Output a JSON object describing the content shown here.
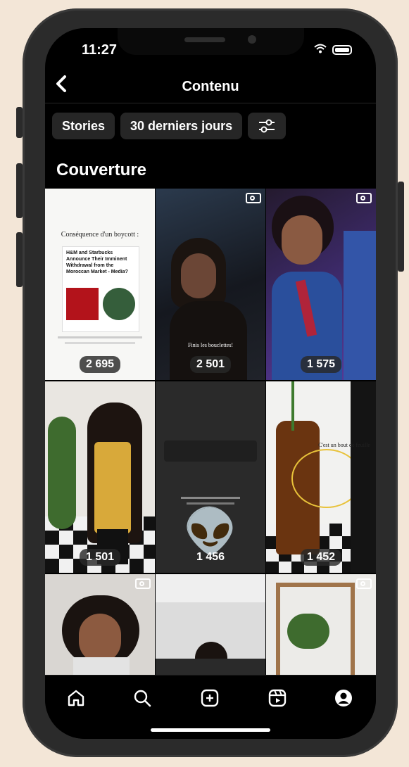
{
  "status_bar": {
    "time": "11:27"
  },
  "header": {
    "title": "Contenu",
    "back_icon": "chevron-left-icon"
  },
  "filters": {
    "chips": [
      {
        "label": "Stories"
      },
      {
        "label": "30 derniers jours"
      }
    ],
    "settings_icon": "sliders-icon"
  },
  "section": {
    "title": "Couverture"
  },
  "grid": {
    "items": [
      {
        "count": "2 695",
        "text": "Conséquence d'un boycott :",
        "headline": "H&M and Starbucks Announce Their Imminent Withdrawal from the Moroccan Market - Media?",
        "reel": false
      },
      {
        "count": "2 501",
        "text": "Finis les bouclettes!",
        "reel": true
      },
      {
        "count": "1 575",
        "reel": true
      },
      {
        "count": "1 501",
        "reel": false
      },
      {
        "count": "1 456",
        "emoji": "👽",
        "reel": false
      },
      {
        "count": "1 452",
        "text": "C'est un bout de feuille",
        "reel": false
      },
      {
        "count": "",
        "reel": true
      },
      {
        "count": "",
        "reel": true
      },
      {
        "count": "",
        "reel": true
      }
    ]
  },
  "nav": {
    "items": [
      "home-icon",
      "search-icon",
      "create-icon",
      "reels-icon",
      "profile-icon"
    ]
  },
  "colors": {
    "background": "#000000",
    "chip": "#262626",
    "page": "#f3e6d7"
  }
}
